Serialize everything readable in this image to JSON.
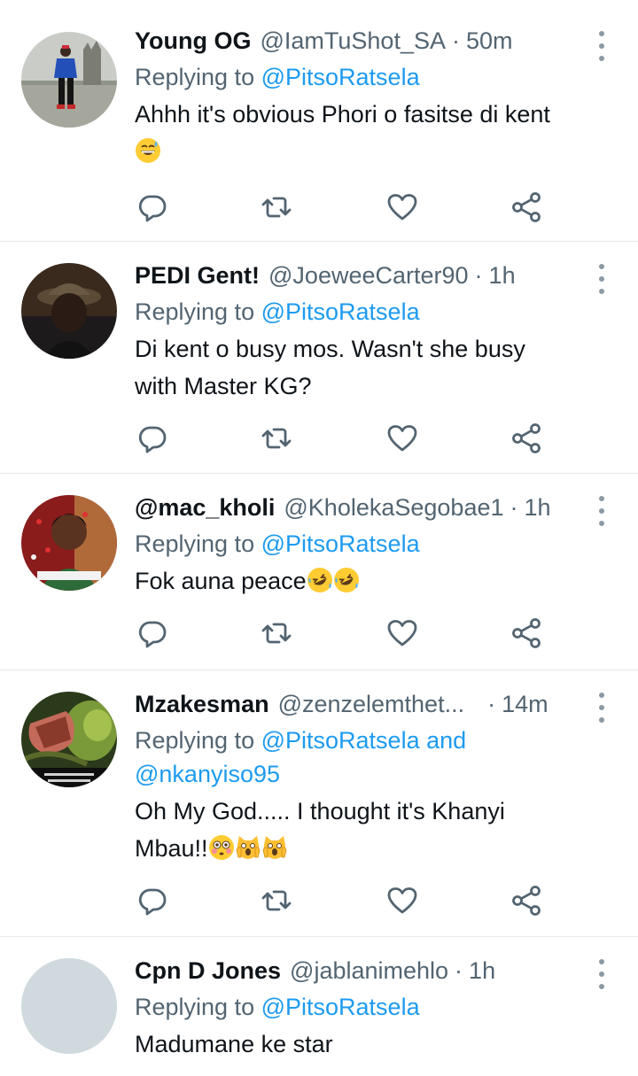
{
  "replying_prefix": "Replying to",
  "tweets": [
    {
      "display_name": "Young OG",
      "handle": "@IamTuShot_SA",
      "time": "50m",
      "replying": [
        {
          "text": "@PitsoRatsela",
          "mention": true
        }
      ],
      "body": "Ahhh it's obvious Phori o fasitse di kent",
      "body_line2": "",
      "emojis": [
        "grinning-sweat"
      ]
    },
    {
      "display_name": "PEDI Gent!",
      "handle": "@JoeweeCarter90",
      "time": "1h",
      "replying": [
        {
          "text": "@PitsoRatsela",
          "mention": true
        }
      ],
      "body": "Di kent o busy mos. Wasn't she busy",
      "body_line2": "with Master KG?",
      "emojis": []
    },
    {
      "display_name": "@mac_kholi",
      "handle": "@KholekaSegobae1",
      "time": "1h",
      "replying": [
        {
          "text": "@PitsoRatsela",
          "mention": true
        }
      ],
      "body": "Fok auna peace",
      "body_line2": "",
      "emojis": [
        "rofl",
        "rofl"
      ]
    },
    {
      "display_name": "Mzakesman",
      "handle": "@zenzelemthet...",
      "time": "14m",
      "replying": [
        {
          "text": "@PitsoRatsela",
          "mention": true
        },
        {
          "text": "and",
          "mention": false
        },
        {
          "text": "@nkanyiso95",
          "mention": true
        }
      ],
      "body": "Oh My God..... I thought it's Khanyi",
      "body_line2": "Mbau!!",
      "emojis": [
        "flushed",
        "scream-cat",
        "scream-cat"
      ]
    },
    {
      "display_name": "Cpn D Jones",
      "handle": "@jablanimehlo",
      "time": "1h",
      "replying": [
        {
          "text": "@PitsoRatsela",
          "mention": true
        }
      ],
      "body": "Madumane ke star",
      "body_line2": "",
      "emojis": []
    }
  ],
  "actions": [
    "reply-icon",
    "retweet-icon",
    "like-icon",
    "share-icon"
  ],
  "colors": {
    "link": "#1d9bf0",
    "secondary": "#536471",
    "text": "#0f1419",
    "divider": "#e6e9eb"
  }
}
